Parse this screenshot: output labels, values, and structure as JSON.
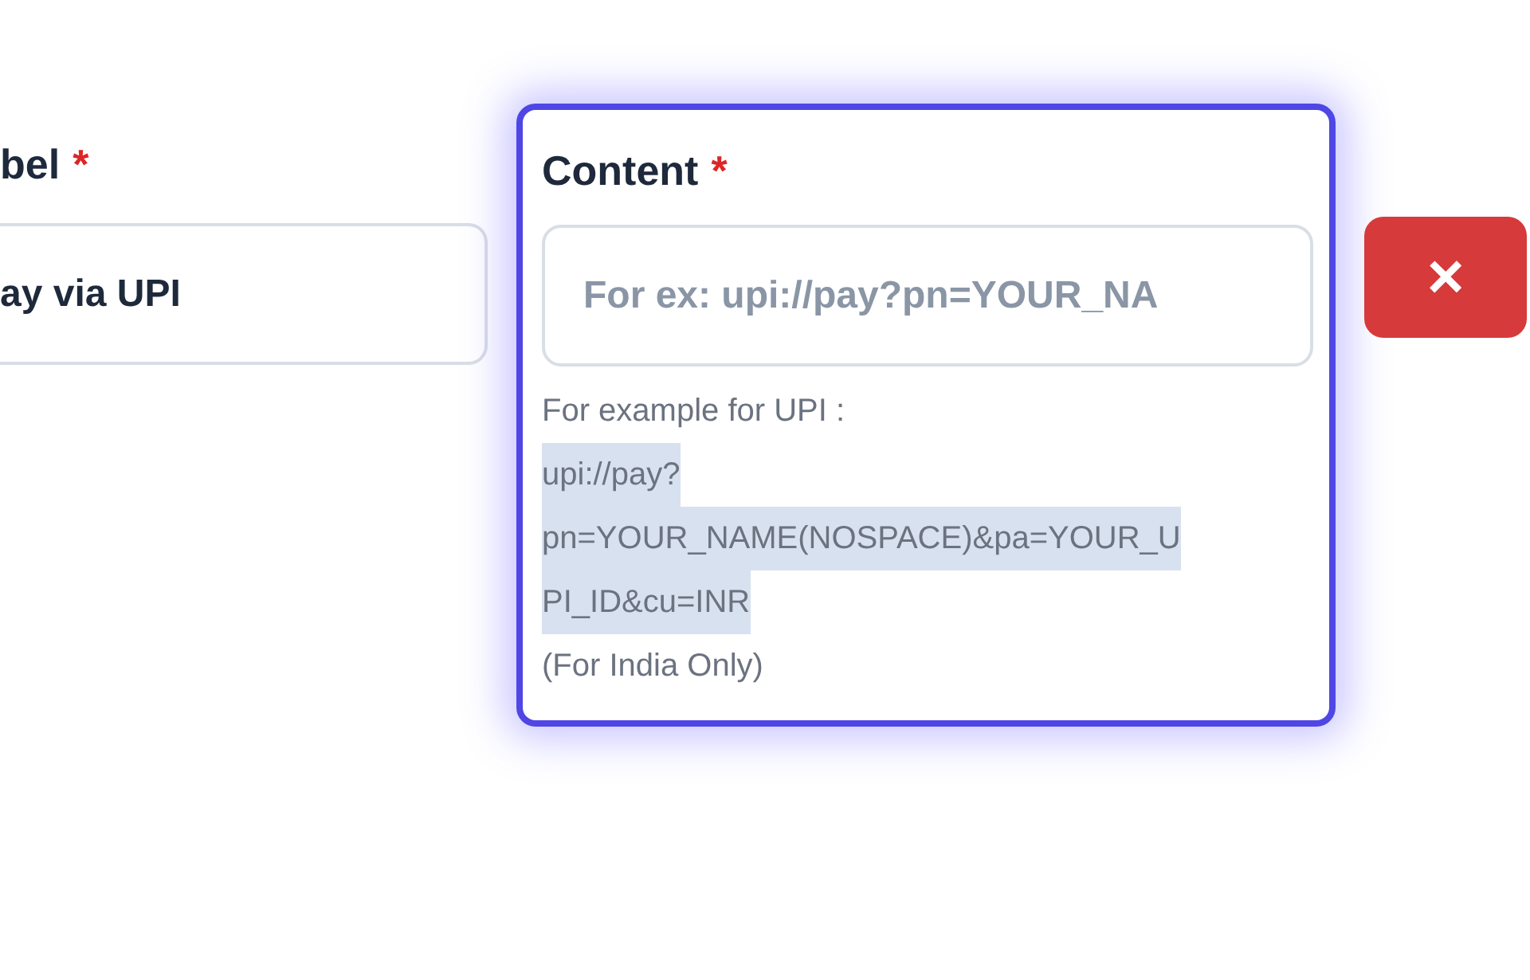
{
  "label_field": {
    "label": "bel",
    "required_mark": "*",
    "value": "ay via UPI"
  },
  "content_field": {
    "label": "Content",
    "required_mark": "*",
    "focused": true,
    "placeholder": "For ex: upi://pay?pn=YOUR_NA",
    "hint": [
      {
        "text": "For example for UPI :",
        "highlighted": false
      },
      {
        "text": "upi://pay?",
        "highlighted": true
      },
      {
        "text": "pn=YOUR_NAME(NOSPACE)&pa=YOUR_U",
        "highlighted": true
      },
      {
        "text": "PI_ID&cu=INR",
        "highlighted": true
      },
      {
        "text": "(For India Only)",
        "highlighted": false
      }
    ]
  },
  "remove_button": {
    "label": "×"
  }
}
